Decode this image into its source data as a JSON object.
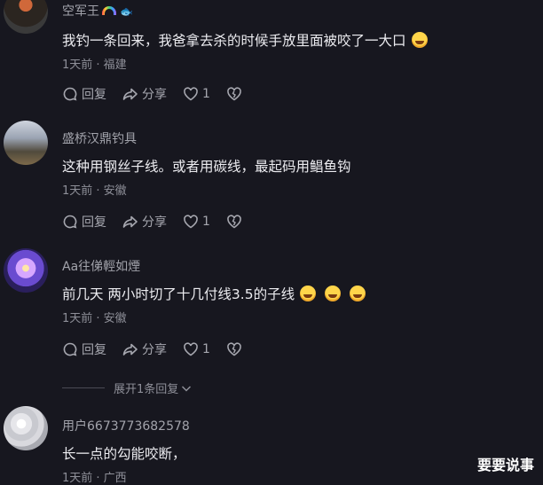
{
  "comments": [
    {
      "username": "空军王",
      "text": "我钓一条回来，我爸拿去杀的时候手放里面被咬了一大口",
      "meta": "1天前 · 福建",
      "reply_label": "回复",
      "share_label": "分享",
      "like_count": "1"
    },
    {
      "username": "盛桥汉鼎钓具",
      "text": "这种用钢丝子线。或者用碳线，最起码用鲳鱼钩",
      "meta": "1天前 · 安徽",
      "reply_label": "回复",
      "share_label": "分享",
      "like_count": "1"
    },
    {
      "username": "Aa往俤輕如煙",
      "text": "前几天   两小时切了十几付线3.5的子线",
      "meta": "1天前 · 安徽",
      "reply_label": "回复",
      "share_label": "分享",
      "like_count": "1"
    },
    {
      "username": "用户6673773682578",
      "text": "长一点的勾能咬断，",
      "meta": "1天前 · 广西"
    }
  ],
  "expand_replies": "展开1条回复",
  "watermark": "要要说事"
}
